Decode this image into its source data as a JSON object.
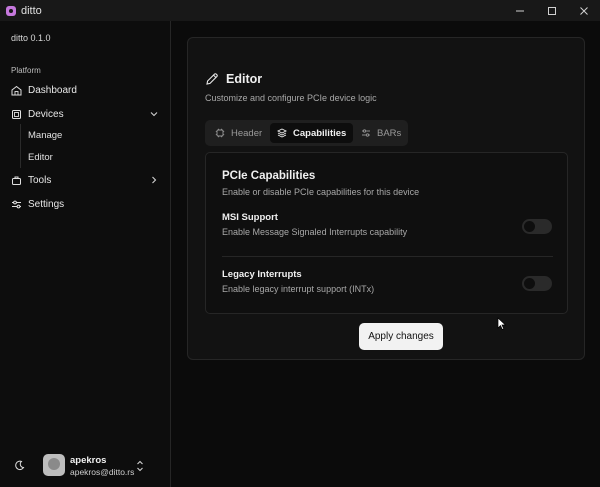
{
  "window": {
    "title": "ditto",
    "icon": "app-icon",
    "controls": [
      "minimize-icon",
      "maximize-icon",
      "close-icon"
    ]
  },
  "sidebar": {
    "version": "ditto 0.1.0",
    "group_label": "Platform",
    "items": [
      {
        "label": "Dashboard",
        "icon": "dashboard-icon"
      },
      {
        "label": "Devices",
        "icon": "devices-icon",
        "expanded": true,
        "children": [
          {
            "label": "Manage"
          },
          {
            "label": "Editor"
          }
        ]
      },
      {
        "label": "Tools",
        "icon": "tools-icon",
        "expanded": false
      },
      {
        "label": "Settings",
        "icon": "settings-icon"
      }
    ],
    "user": {
      "name": "apekros",
      "email": "apekros@ditto.rs"
    }
  },
  "editor": {
    "title": "Editor",
    "subtitle": "Customize and configure PCIe device logic",
    "tabs": [
      {
        "label": "Header",
        "icon": "header-icon",
        "active": false
      },
      {
        "label": "Capabilities",
        "icon": "layers-icon",
        "active": true
      },
      {
        "label": "BARs",
        "icon": "bars-icon",
        "active": false
      }
    ],
    "section": {
      "title": "PCIe Capabilities",
      "subtitle": "Enable or disable PCIe capabilities for this device",
      "settings": [
        {
          "title": "MSI Support",
          "description": "Enable Message Signaled Interrupts capability",
          "enabled": false
        },
        {
          "title": "Legacy Interrupts",
          "description": "Enable legacy interrupt support (INTx)",
          "enabled": false
        }
      ]
    },
    "apply_label": "Apply changes"
  },
  "colors": {
    "background": "#0b0b0b",
    "card": "#121212",
    "border": "#262626",
    "button_bg": "#f2f2f2",
    "muted_text": "#a8a8a8"
  }
}
